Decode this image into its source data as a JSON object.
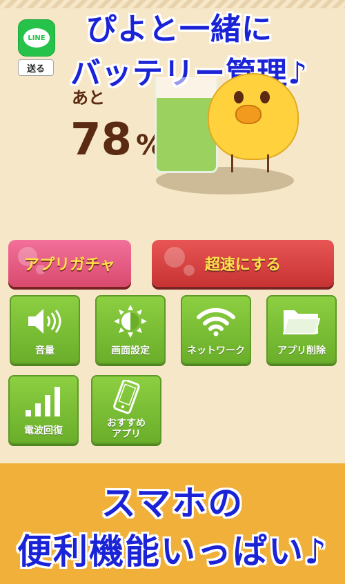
{
  "headline": {
    "line1": "ぴよと一緒に",
    "line2": "バッテリー管理♪"
  },
  "share": {
    "logo_text": "LINE",
    "send_label": "送る"
  },
  "battery": {
    "remaining_label": "あと",
    "level": "78",
    "unit": "%",
    "fill_fraction": 0.78
  },
  "buttons": {
    "gacha": "アプリガチャ",
    "speedup": "超速にする"
  },
  "tools": [
    {
      "label": "音量",
      "icon": "speaker-icon"
    },
    {
      "label": "画面設定",
      "icon": "brightness-icon"
    },
    {
      "label": "ネットワーク",
      "icon": "wifi-icon"
    },
    {
      "label": "アプリ削除",
      "icon": "folder-icon"
    },
    {
      "label": "電波回復",
      "icon": "signal-bars-icon"
    },
    {
      "label_line1": "おすすめ",
      "label_line2": "アプリ",
      "icon": "smartphone-icon"
    }
  ],
  "footer": {
    "line1": "スマホの",
    "line2": "便利機能いっぱい♪"
  },
  "colors": {
    "headline": "#1b23d6",
    "tile": "#7cbf35",
    "gacha": "#e65a82",
    "speedup": "#d64242",
    "footer_bg": "#f0b03a"
  }
}
